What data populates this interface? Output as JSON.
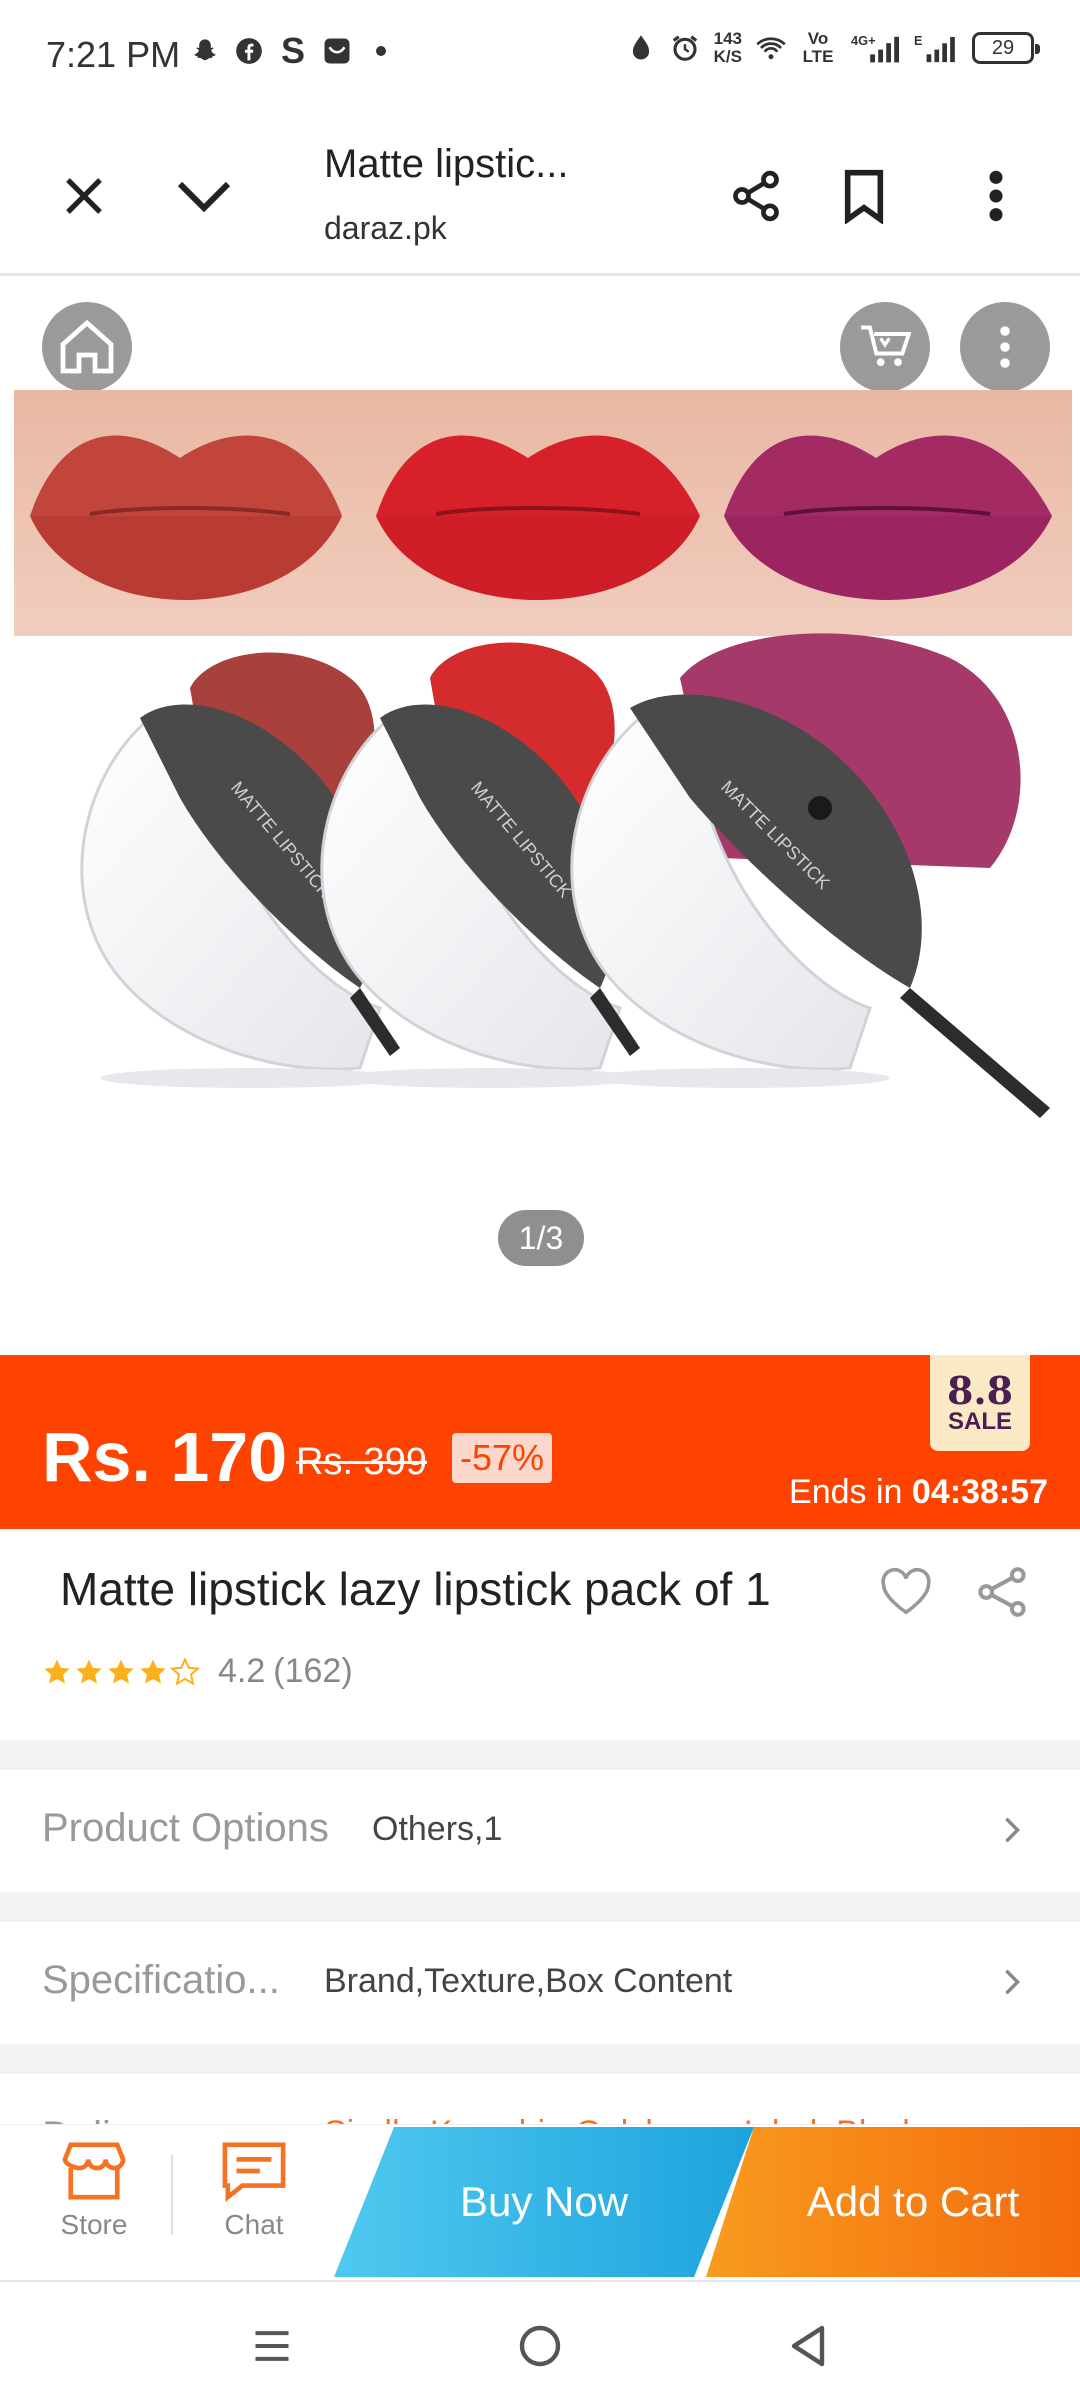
{
  "status_bar": {
    "time": "7:21 PM",
    "net_speed_value": "143",
    "net_speed_unit": "K/S",
    "network_label": "Vo LTE",
    "signal_4g": "4G+",
    "signal_e": "E",
    "battery": "29"
  },
  "browser": {
    "title": "Matte lipstic...",
    "url": "daraz.pk"
  },
  "gallery": {
    "counter": "1/3",
    "product_text": "MATTE LIPSTICK"
  },
  "price": {
    "current": "Rs. 170",
    "original": "Rs. 399",
    "discount": "-57%",
    "sale_badge_top": "8.8",
    "sale_badge_bottom": "SALE",
    "ends_in_label": "Ends in ",
    "ends_in_time": "04:38:57"
  },
  "product": {
    "title": "Matte lipstick lazy lipstick pack of 1",
    "rating": "4.2",
    "rating_count": "(162)"
  },
  "options": [
    {
      "label": "Product Options",
      "value": "Others,1"
    },
    {
      "label": "Specificatio...",
      "value": "Brand,Texture,Box Content"
    }
  ],
  "delivery_peek": {
    "label": "Delivery",
    "value": "Sindh, Karachi - Gulshan-e-Iqbal, Block..."
  },
  "action_bar": {
    "store_label": "Store",
    "chat_label": "Chat",
    "buy_now": "Buy Now",
    "add_to_cart": "Add to Cart"
  },
  "colors": {
    "daraz_orange": "#fe4301",
    "buy_now_blue": "#1da3dd",
    "add_cart_orange": "#f46b0d",
    "lip_shades": [
      "#c2453b",
      "#d8202a",
      "#a32a63"
    ]
  }
}
